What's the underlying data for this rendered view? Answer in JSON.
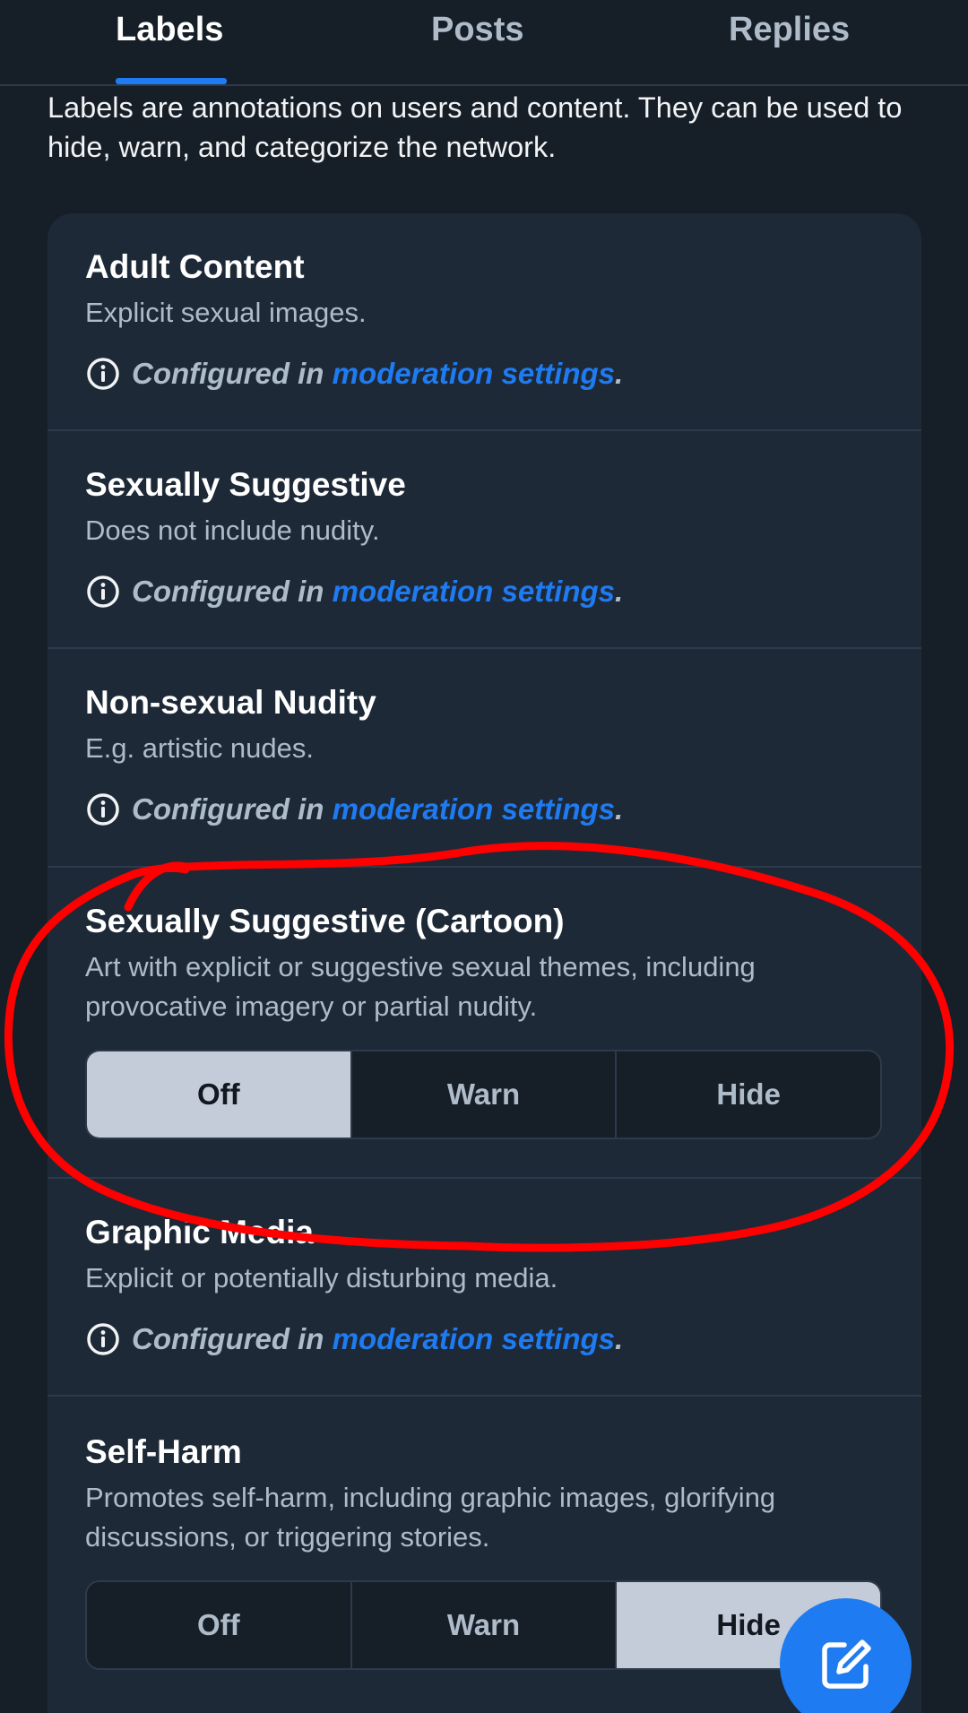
{
  "tabs": [
    {
      "label": "Labels",
      "active": true
    },
    {
      "label": "Posts",
      "active": false
    },
    {
      "label": "Replies",
      "active": false
    }
  ],
  "intro": "Labels are annotations on users and content. They can be used to hide, warn, and categorize the network.",
  "configured": {
    "prefix": "Configured in ",
    "link": "moderation settings",
    "suffix": "."
  },
  "sections": [
    {
      "title": "Adult Content",
      "desc": "Explicit sexual images.",
      "mode": "configured"
    },
    {
      "title": "Sexually Suggestive",
      "desc": "Does not include nudity.",
      "mode": "configured"
    },
    {
      "title": "Non-sexual Nudity",
      "desc": "E.g. artistic nudes.",
      "mode": "configured"
    },
    {
      "title": "Sexually Suggestive (Cartoon)",
      "desc": "Art with explicit or suggestive sexual themes, including provocative imagery or partial nudity.",
      "mode": "toggle",
      "selected": "Off"
    },
    {
      "title": "Graphic Media",
      "desc": "Explicit or potentially disturbing media.",
      "mode": "configured"
    },
    {
      "title": "Self-Harm",
      "desc": "Promotes self-harm, including graphic images, glorifying discussions, or triggering stories.",
      "mode": "toggle",
      "selected": "Hide"
    }
  ],
  "toggle_options": [
    "Off",
    "Warn",
    "Hide"
  ],
  "colors": {
    "background": "#161e27",
    "card": "#1e2937",
    "accent": "#1f7bf2",
    "selected_segment": "#c3ccd8",
    "annotation": "#ff0000"
  },
  "icons": {
    "info": "info-circle-icon",
    "compose": "compose-pencil-icon"
  }
}
